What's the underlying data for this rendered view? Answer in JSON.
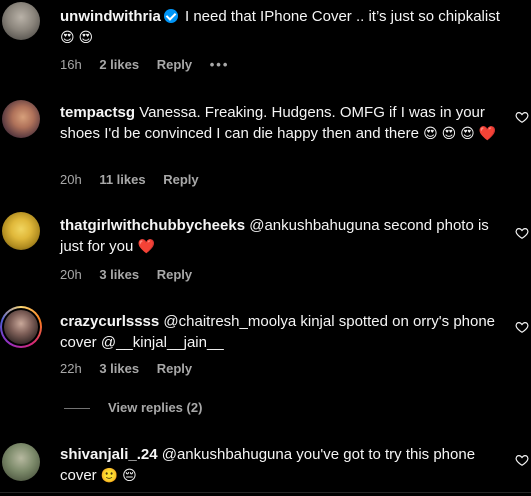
{
  "comments": [
    {
      "username": "unwindwithria",
      "verified": true,
      "text": "I need that IPhone Cover .. it’s just so chipkalist",
      "emojis": "😍 😍",
      "time": "16h",
      "likes": "2 likes",
      "reply": "Reply",
      "more": "•••"
    },
    {
      "username": "tempactsg",
      "text": "Vanessa. Freaking. Hudgens. OMFG if I was in your shoes I'd be convinced I can die happy then and there",
      "emojis": "😍 😍 😍 ❤️",
      "time": "20h",
      "likes": "11 likes",
      "reply": "Reply"
    },
    {
      "username": "thatgirlwithchubbycheeks",
      "text": "@ankushbahuguna second photo is just for you",
      "emojis": "❤️",
      "time": "20h",
      "likes": "3 likes",
      "reply": "Reply"
    },
    {
      "username": "crazycurlssss",
      "text": "@chaitresh_moolya kinjal spotted on orry's phone cover @__kinjal__jain__",
      "time": "22h",
      "likes": "3 likes",
      "reply": "Reply",
      "view_replies": "View replies (2)"
    },
    {
      "username": "shivanjali_.24",
      "text": "@ankushbahuguna you've got to try this phone cover",
      "emojis": "🙂 😔"
    }
  ],
  "icons": {
    "like": "heart-outline-icon",
    "verified": "verified-badge-icon",
    "more": "more-options-icon"
  },
  "colors": {
    "background": "#000000",
    "text": "#f5f5f5",
    "secondary": "#a8a8a8",
    "verified": "#0095f6",
    "heart": "#ff3040"
  }
}
